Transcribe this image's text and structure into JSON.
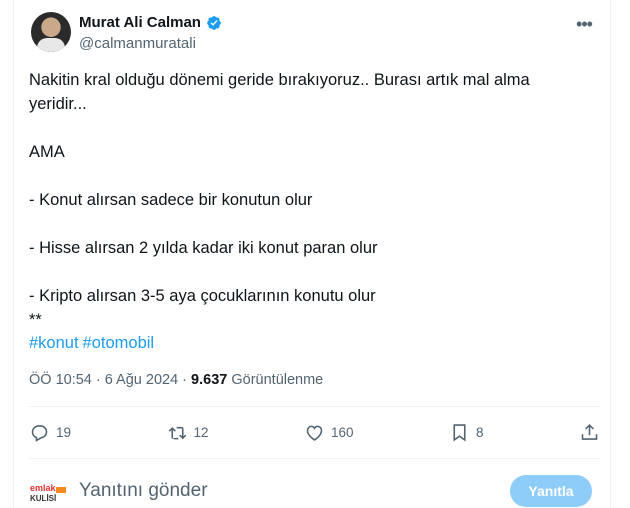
{
  "tweet": {
    "author_name": "Murat Ali Calman",
    "author_handle": "@calmanmuratali",
    "text": "Nakitin kral olduğu dönemi geride bırakıyoruz.. Burası artık mal alma\nyeridir...\n\nAMA\n\n- Konut alırsan sadece bir konutun olur\n\n- Hisse alırsan 2 yılda kadar iki konut paran olur\n\n- Kripto alırsan 3-5 aya çocuklarının konutu olur\n**",
    "hashtags": [
      "#konut",
      "#otomobil"
    ],
    "time": "ÖÖ 10:54 · 6 Ağu 2024 ·",
    "views": "9.637",
    "views_label": "Görüntülenme"
  },
  "actions": {
    "replies": "19",
    "retweets": "12",
    "likes": "160",
    "bookmarks": "8"
  },
  "reply": {
    "placeholder": "Yanıtını gönder",
    "button_label": "Yanıtla",
    "avatar_text": "emlak KULİSİ"
  },
  "colors": {
    "accent": "#1d9bf0",
    "button_disabled": "#8ecdf8",
    "secondary_text": "#536471"
  },
  "icons": [
    "verified-icon",
    "more-icon",
    "reply-icon",
    "retweet-icon",
    "like-icon",
    "bookmark-icon",
    "share-icon"
  ]
}
